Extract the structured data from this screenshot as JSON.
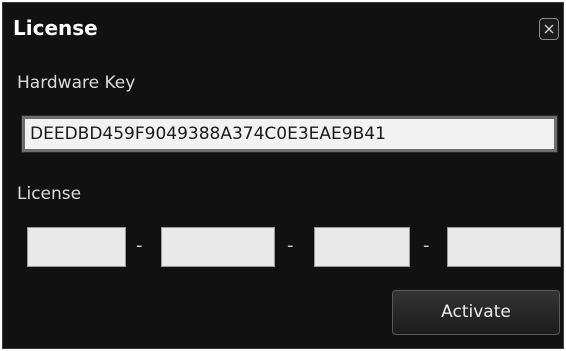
{
  "dialog": {
    "title": "License",
    "close_icon": "close-icon"
  },
  "hardware_key": {
    "label": "Hardware Key",
    "value": "DEEDBD459F9049388A374C0E3EAE9B41"
  },
  "license": {
    "label": "License",
    "segments": [
      "",
      "",
      "",
      ""
    ],
    "separator": "-"
  },
  "actions": {
    "activate_label": "Activate"
  },
  "colors": {
    "background": "#111111",
    "text": "#dcdcdc",
    "field_bg": "#f2f2f2"
  }
}
